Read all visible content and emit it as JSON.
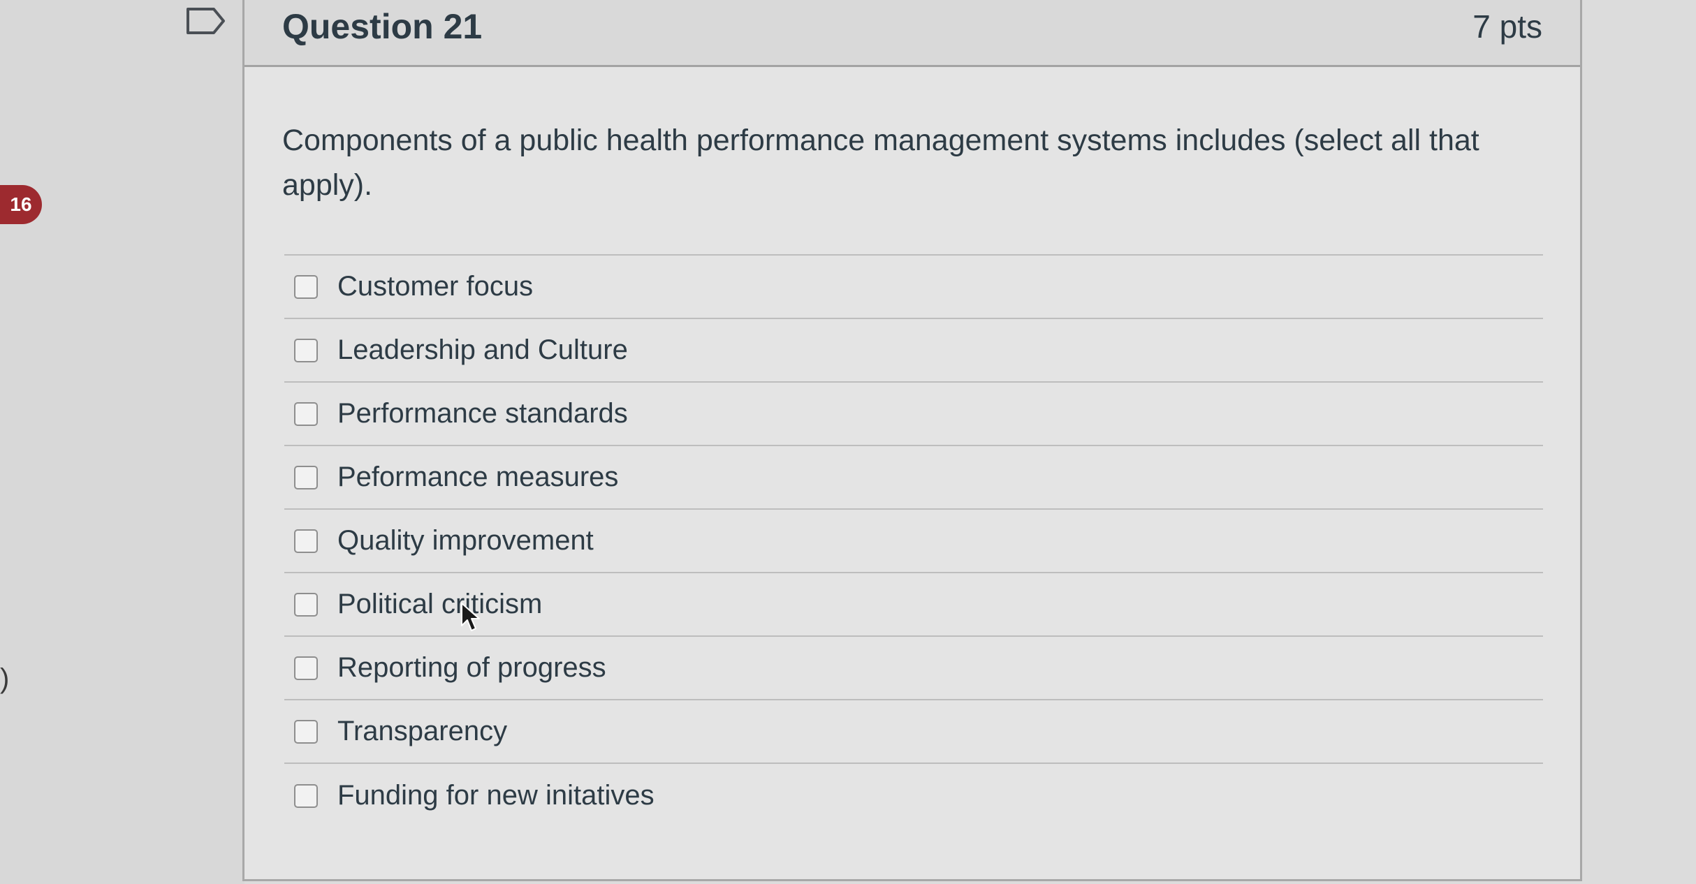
{
  "sidebar": {
    "badge_count": "16",
    "edge_mark": ")"
  },
  "question": {
    "title": "Question 21",
    "points": "7 pts",
    "text": "Components of a public health performance management systems includes (select all that apply).",
    "answers": [
      {
        "label": "Customer focus",
        "checked": false
      },
      {
        "label": "Leadership and Culture",
        "checked": false
      },
      {
        "label": "Performance standards",
        "checked": false
      },
      {
        "label": "Peformance measures",
        "checked": false
      },
      {
        "label": "Quality improvement",
        "checked": false
      },
      {
        "label": "Political criticism",
        "checked": false
      },
      {
        "label": "Reporting of progress",
        "checked": false
      },
      {
        "label": "Transparency",
        "checked": false
      },
      {
        "label": "Funding for new initatives",
        "checked": false
      }
    ]
  },
  "icons": {
    "flag": "flag-outline-icon",
    "cursor": "mouse-pointer-icon"
  },
  "colors": {
    "badge": "#9d2a2f",
    "text": "#2d3b45",
    "header_bg": "#d9d9d9",
    "panel_bg": "#e4e4e4"
  }
}
